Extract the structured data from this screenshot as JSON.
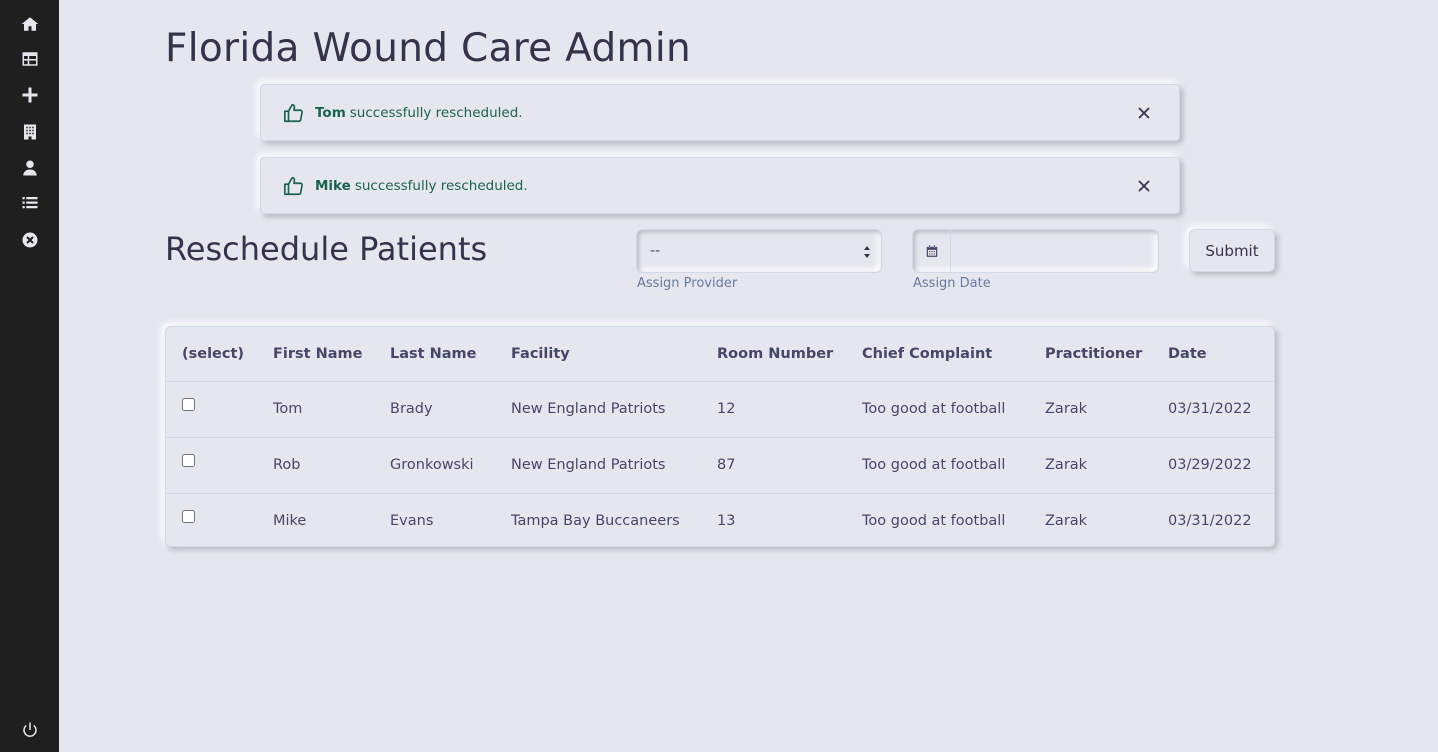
{
  "sidebar": {
    "items": [
      {
        "icon": "home-icon"
      },
      {
        "icon": "table-icon"
      },
      {
        "icon": "plus-icon"
      },
      {
        "icon": "building-icon"
      },
      {
        "icon": "user-doctor-icon"
      },
      {
        "icon": "list-icon"
      },
      {
        "icon": "times-circle-icon"
      }
    ],
    "footer_icon": "power-icon"
  },
  "page": {
    "title": "Florida Wound Care Admin"
  },
  "alerts": [
    {
      "name": "Tom",
      "message": "successfully rescheduled."
    },
    {
      "name": "Mike",
      "message": "successfully rescheduled."
    }
  ],
  "reschedule": {
    "title": "Reschedule Patients",
    "provider_select": {
      "value": "--",
      "label": "Assign Provider"
    },
    "date_input": {
      "value": "",
      "label": "Assign Date"
    },
    "submit_label": "Submit"
  },
  "table": {
    "headers": [
      "(select)",
      "First Name",
      "Last Name",
      "Facility",
      "Room Number",
      "Chief Complaint",
      "Practitioner",
      "Date"
    ],
    "rows": [
      {
        "first": "Tom",
        "last": "Brady",
        "facility": "New England Patriots",
        "room": "12",
        "complaint": "Too good at football",
        "practitioner": "Zarak",
        "date": "03/31/2022"
      },
      {
        "first": "Rob",
        "last": "Gronkowski",
        "facility": "New England Patriots",
        "room": "87",
        "complaint": "Too good at football",
        "practitioner": "Zarak",
        "date": "03/29/2022"
      },
      {
        "first": "Mike",
        "last": "Evans",
        "facility": "Tampa Bay Buccaneers",
        "room": "13",
        "complaint": "Too good at football",
        "practitioner": "Zarak",
        "date": "03/31/2022"
      }
    ]
  },
  "colors": {
    "background": "#e6e7ee",
    "sidebar": "#1f1f1f",
    "success": "#18634b",
    "text": "#31344b"
  }
}
